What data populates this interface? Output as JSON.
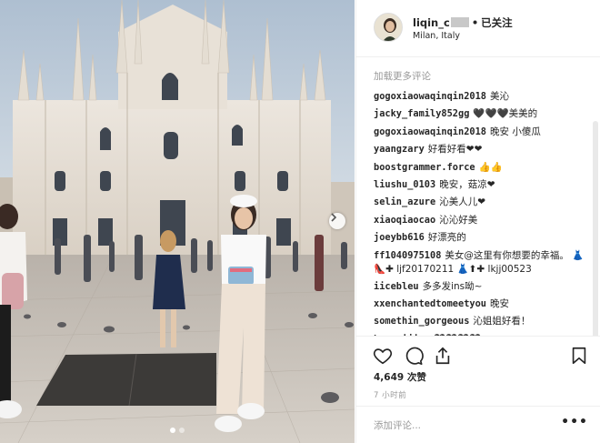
{
  "post": {
    "username": "liqin_c",
    "separator": "•",
    "follow_status": "已关注",
    "location": "Milan, Italy",
    "avatar_icon": "profile-photo-avatar"
  },
  "comments": {
    "load_more": "加载更多评论",
    "items": [
      {
        "user": "gogoxiaowaqinqin2018",
        "text": "美沁"
      },
      {
        "user": "jacky_family852gg",
        "text": "🖤🖤🖤美美的"
      },
      {
        "user": "gogoxiaowaqinqin2018",
        "text": "晚安 小傻瓜"
      },
      {
        "user": "yaangzary",
        "text": "好看好看❤❤"
      },
      {
        "user": "boostgrammer.force",
        "text": "👍👍"
      },
      {
        "user": "liushu_0103",
        "text": "晚安，菇凉❤"
      },
      {
        "user": "selin_azure",
        "text": "沁美人儿❤"
      },
      {
        "user": "xiaoqiaocao",
        "text": "沁沁好美"
      },
      {
        "user": "joeybb616",
        "text": "好漂亮的"
      },
      {
        "user": "ff1040975108",
        "text": "美女@这里有你想要的幸福。 👗👠✚ ljf20170211 👗⬆✚ lkjj00523"
      },
      {
        "user": "iicebleu",
        "text": "多多发ins呦~"
      },
      {
        "user": "xxenchantedtomeetyou",
        "text": "晚安"
      },
      {
        "user": "somethin_gorgeous",
        "text": "沁姐姐好看！"
      },
      {
        "user": "huanyijing",
        "text": "🖤🖤🖤🖤"
      }
    ]
  },
  "actions": {
    "like_icon": "heart-icon",
    "comment_icon": "comment-bubble-icon",
    "share_icon": "share-icon",
    "save_icon": "bookmark-icon"
  },
  "likes": "4,649 次赞",
  "timestamp": "7 小时前",
  "add_comment": {
    "placeholder": "添加评论...",
    "more_label": "•••"
  },
  "colors": {
    "text": "#262626",
    "muted": "#999999",
    "divider": "#efefef"
  }
}
